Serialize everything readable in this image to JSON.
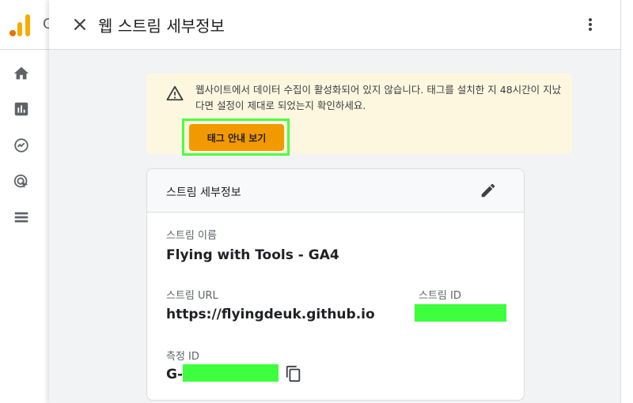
{
  "app": {
    "peek_letter": "G"
  },
  "panel": {
    "title": "웹 스트림 세부정보"
  },
  "warning": {
    "message": "웹사이트에서 데이터 수집이 활성화되어 있지 않습니다. 태그를 설치한 지 48시간이 지났다면 설정이 제대로 되었는지 확인하세요.",
    "button_label": "태그 안내 보기",
    "highlight_color": "#4cff3d",
    "button_color": "#f29900",
    "background": "#fef7e0"
  },
  "stream_details": {
    "title": "스트림 세부정보",
    "stream_name_label": "스트림 이름",
    "stream_name": "Flying with Tools - GA4",
    "stream_url_label": "스트림 URL",
    "stream_url": "https://flyingdeuk.github.io",
    "stream_id_label": "스트림 ID",
    "measurement_id_label": "측정 ID",
    "measurement_id_prefix": "G-",
    "redaction_color": "#3dff3d"
  },
  "icons": {
    "close": "close-icon",
    "more": "more-vert-icon",
    "warning": "warning-icon",
    "edit": "edit-pencil-icon",
    "copy": "copy-icon",
    "home": "home-icon",
    "reports": "bar-chart-icon",
    "explore": "explore-icon",
    "advertising": "advertising-icon",
    "configure": "list-icon"
  }
}
